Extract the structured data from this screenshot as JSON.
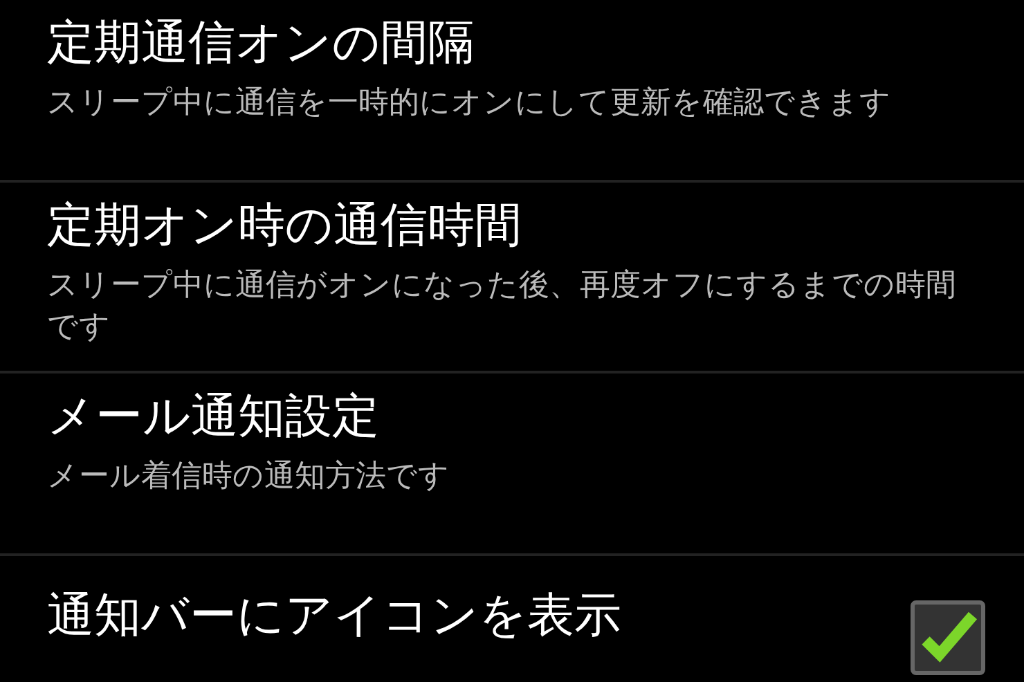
{
  "items": [
    {
      "kind": "plain",
      "title": "定期通信オンの間隔",
      "summary": "スリープ中に通信を一時的にオンにして更新を確認できます"
    },
    {
      "kind": "plain",
      "title": "定期オン時の通信時間",
      "summary": "スリープ中に通信がオンになった後、再度オフにするまでの時間です"
    },
    {
      "kind": "plain",
      "title": "メール通知設定",
      "summary": "メール着信時の通知方法です"
    },
    {
      "kind": "checkbox",
      "title": "通知バーにアイコンを表示",
      "checked": true
    }
  ]
}
